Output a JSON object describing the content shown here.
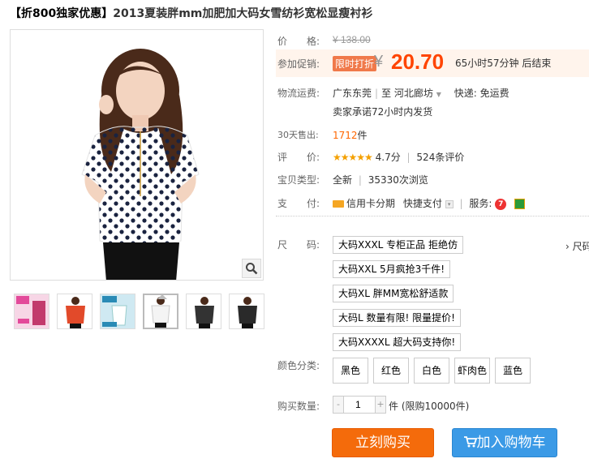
{
  "product": {
    "title_promo": "【折800独家优惠】",
    "title_name": "2013夏装胖mm加肥加大码女雪纺衫宽松显瘦衬衫"
  },
  "price": {
    "label": "价　　格:",
    "original": "¥ 138.00"
  },
  "promotion": {
    "label": "参加促销:",
    "tag": "限时打折",
    "currency": "¥",
    "price": "20.70",
    "countdown": "65小时57分钟 后结束"
  },
  "shipping": {
    "label": "物流运费:",
    "from": "广东东莞",
    "to_prefix": "至",
    "to": "河北廊坊",
    "fee": "快递: 免运费",
    "promise": "卖家承诺72小时内发货"
  },
  "sales": {
    "label": "30天售出:",
    "count": "1712",
    "unit": "件"
  },
  "rating": {
    "label": "评　　价:",
    "stars": "★★★★★",
    "score": "4.7分",
    "reviews": "524条评价"
  },
  "item_type": {
    "label": "宝贝类型:",
    "condition": "全新",
    "views": "35330次浏览"
  },
  "payment": {
    "label": "支　　付:",
    "credit": "信用卡分期",
    "quick": "快捷支付",
    "service_label": "服务:"
  },
  "size": {
    "label": "尺　　码:",
    "options": [
      "大码XXXL 专柜正品 拒绝仿",
      "大码XXL 5月疯抢3千件!",
      "大码XL 胖MM宽松舒适款",
      "大码L 数量有限! 限量提价!",
      "大码XXXXL 超大码支持你!"
    ],
    "guide": "› 尺码"
  },
  "color": {
    "label": "颜色分类:",
    "options": [
      "黑色",
      "红色",
      "白色",
      "虾肉色",
      "蓝色"
    ]
  },
  "quantity": {
    "label": "购买数量:",
    "minus": "-",
    "value": "1",
    "plus": "+",
    "unit_limit": "件 (限购10000件)"
  },
  "actions": {
    "buy_now": "立刻购买",
    "add_cart": "加入购物车"
  },
  "colors": {
    "price": "#ff4400",
    "tag_bg": "#f0794a",
    "buy_btn": "#f46b0b",
    "cart_btn": "#3b9ae6"
  }
}
